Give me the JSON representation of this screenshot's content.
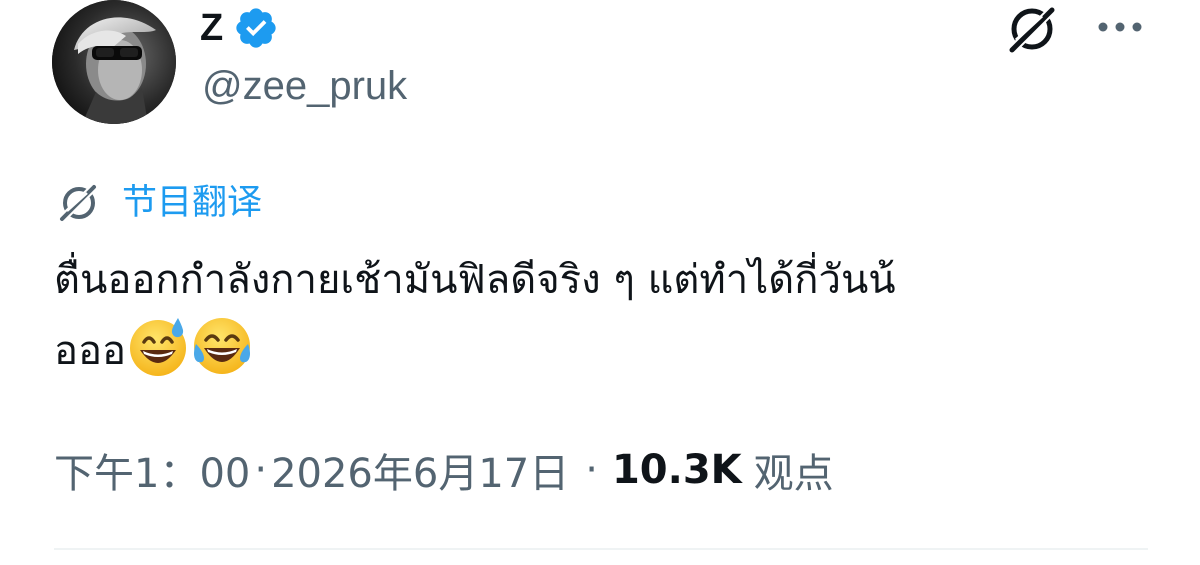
{
  "author": {
    "display_name": "Z",
    "handle": "@zee_pruk",
    "verified": true,
    "verified_color": "#1d9bf0"
  },
  "header": {
    "grok_icon": "grok-icon",
    "more_icon": "more-horizontal-icon"
  },
  "translate": {
    "icon": "grok-translate-icon",
    "label": "节目翻译",
    "color": "#1d9bf0"
  },
  "tweet": {
    "line1": "ตื่นออกกำลังกายเช้ามันฟิลดีจริง ๆ แต่ทำได้กี่วันน้",
    "line2": "อออ",
    "emojis": [
      "grinning-face-with-sweat-emoji",
      "face-with-tears-of-joy-emoji"
    ]
  },
  "meta": {
    "time": "下午1：00",
    "separator": "·",
    "date": "2026年6月17日",
    "separator2": "·",
    "views_count": "10.3K",
    "views_label": "观点"
  },
  "colors": {
    "text_primary": "#0f1419",
    "text_secondary": "#536471",
    "accent": "#1d9bf0",
    "divider": "#eff3f4"
  }
}
